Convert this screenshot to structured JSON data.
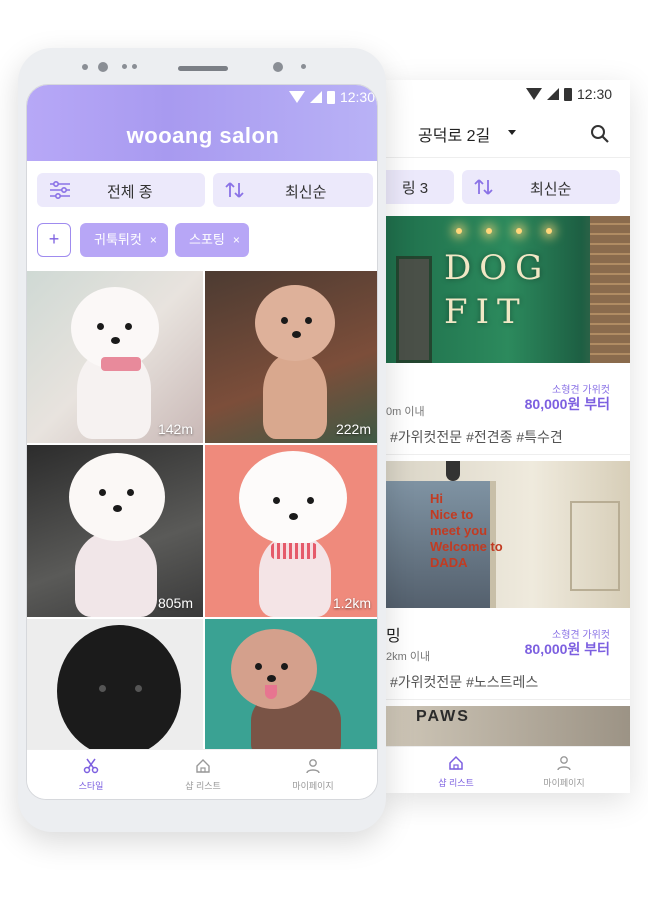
{
  "back_phone": {
    "status_time": "12:30",
    "location": "공덕로 2길",
    "chips": {
      "partial": "링 3",
      "sort": "최신순"
    },
    "shops": [
      {
        "distance": "0m 이내",
        "price_label": "소형견 가위컷",
        "price": "80,000원 부터",
        "tags": "#가위컷전문 #전견종 #특수견"
      },
      {
        "name": "밍",
        "distance": "2km 이내",
        "price_label": "소형견 가위컷",
        "price": "80,000원 부터",
        "tags": "#가위컷전문 #노스트레스",
        "window_text": "Hi\nNice to\nmeet you\nWelcome to\nDADA"
      },
      {
        "sign": "PAWS"
      }
    ],
    "shop1_sign": "DOG\nFIT",
    "nav": {
      "shop_list": "샵 리스트",
      "mypage": "마이페이지"
    }
  },
  "front_phone": {
    "status_time": "12:30",
    "brand": "wooang salon",
    "filter_breed": "전체 종",
    "filter_sort": "최신순",
    "add_label": "+",
    "tags": [
      "귀툭튀컷",
      "스포팅"
    ],
    "tag_remove": "×",
    "grid_distances": [
      "142m",
      "222m",
      "805m",
      "1.2km"
    ],
    "nav": {
      "style": "스타일",
      "shop_list": "샵 리스트",
      "mypage": "마이페이지"
    }
  },
  "colors": {
    "accent": "#7c5fe0",
    "chip_bg": "#ece9fb",
    "tag_bg": "#b7a6f6",
    "header": "#b1a3f5"
  }
}
